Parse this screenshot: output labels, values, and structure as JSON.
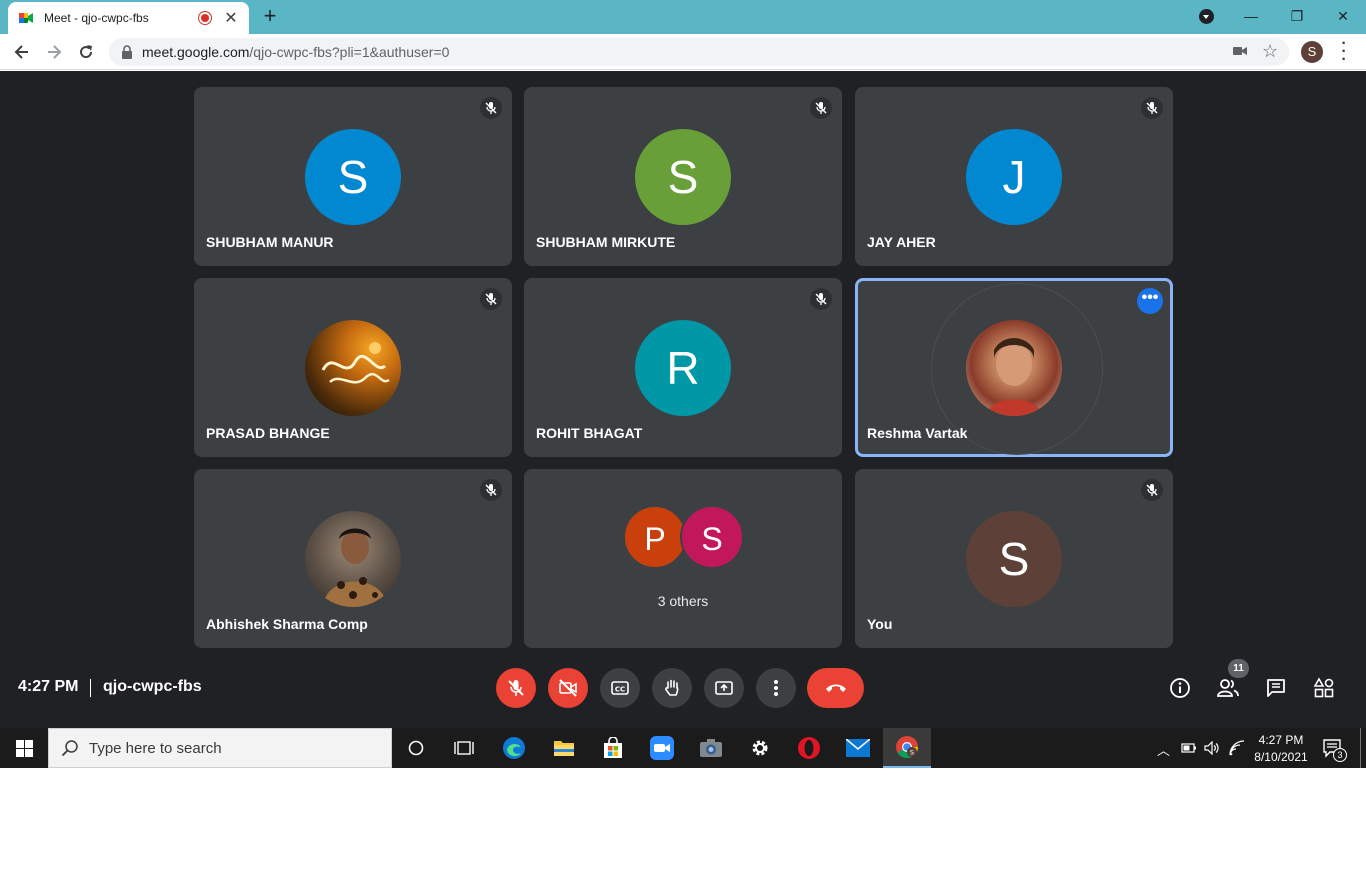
{
  "browser": {
    "tab_title": "Meet - qjo-cwpc-fbs",
    "new_tab": "+",
    "url_host": "meet.google.com",
    "url_rest": "/qjo-cwpc-fbs?pli=1&authuser=0",
    "profile_initial": "S",
    "window_buttons": {
      "minimize": "—",
      "restore": "❐",
      "close": "✕"
    }
  },
  "tiles": [
    {
      "name": "SHUBHAM MANUR",
      "initial": "S",
      "color": "#0288d1",
      "muted": true
    },
    {
      "name": "SHUBHAM MIRKUTE",
      "initial": "S",
      "color": "#689f38",
      "muted": true
    },
    {
      "name": "JAY AHER",
      "initial": "J",
      "color": "#0288d1",
      "muted": true
    },
    {
      "name": "PRASAD BHANGE",
      "initial": "",
      "color": "#5a3a1a",
      "muted": true,
      "photo": true
    },
    {
      "name": "ROHIT BHAGAT",
      "initial": "R",
      "color": "#0097a7",
      "muted": true
    },
    {
      "name": "Reshma Vartak",
      "initial": "",
      "color": "#c9a27a",
      "muted": false,
      "photo": true,
      "active": true
    },
    {
      "name": "Abhishek Sharma Comp",
      "initial": "",
      "color": "#6b5a4a",
      "muted": true,
      "photo": true
    },
    {
      "name": "3 others",
      "others": [
        {
          "initial": "P",
          "color": "#c9400c"
        },
        {
          "initial": "S",
          "color": "#c2185b"
        }
      ]
    },
    {
      "name": "You",
      "initial": "S",
      "color": "#5d4037",
      "muted": true
    }
  ],
  "meet_bar": {
    "time": "4:27 PM",
    "meeting_code": "qjo-cwpc-fbs",
    "people_count": "11"
  },
  "taskbar": {
    "search_placeholder": "Type here to search",
    "time": "4:27 PM",
    "date": "8/10/2021",
    "notification_count": "3"
  },
  "colors": {
    "stage_bg": "#202124",
    "tile_bg": "#3c4043",
    "danger": "#ea4335",
    "accent": "#1a73e8",
    "active_border": "#8ab4f8"
  }
}
